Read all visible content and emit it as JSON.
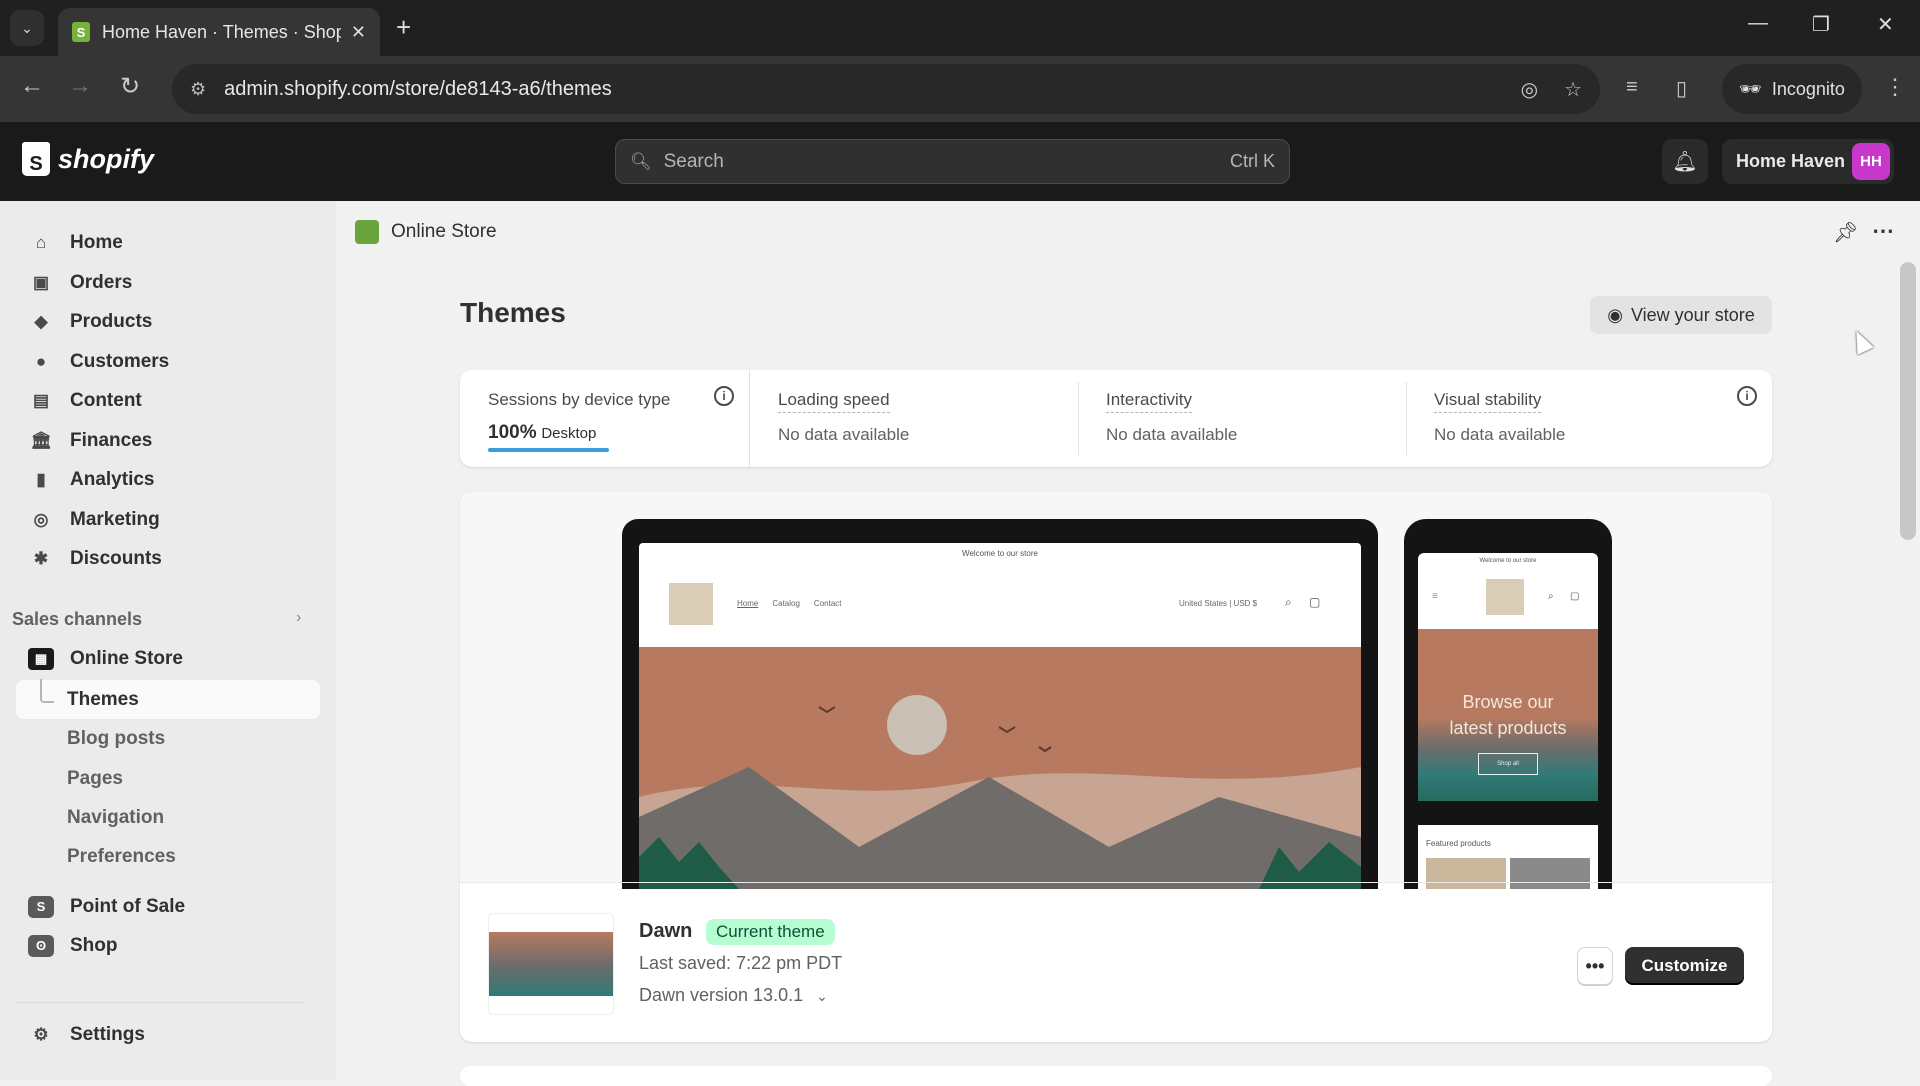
{
  "browser": {
    "tab_title": "Home Haven · Themes · Shopify",
    "url": "admin.shopify.com/store/de8143-a6/themes",
    "profile_label": "Incognito",
    "new_tab_symbol": "+",
    "icons": [
      "tab-search-icon",
      "shopify-favicon",
      "close-tab-icon",
      "back-icon",
      "forward-icon",
      "reload-icon",
      "site-settings-icon",
      "eye-off-icon",
      "star-icon",
      "media-icon",
      "sidebar-icon",
      "incognito-icon",
      "menu-icon",
      "minimize-icon",
      "restore-icon",
      "close-window-icon"
    ]
  },
  "topbar": {
    "logo_text": "shopify",
    "search_placeholder": "Search",
    "search_shortcut": "Ctrl K",
    "store_name": "Home Haven",
    "avatar_initials": "HH",
    "avatar_color": "#c837cb"
  },
  "sidebar": {
    "items": [
      {
        "label": "Home",
        "icon": "home-icon"
      },
      {
        "label": "Orders",
        "icon": "orders-icon"
      },
      {
        "label": "Products",
        "icon": "tag-icon"
      },
      {
        "label": "Customers",
        "icon": "person-icon"
      },
      {
        "label": "Content",
        "icon": "content-icon"
      },
      {
        "label": "Finances",
        "icon": "bank-icon"
      },
      {
        "label": "Analytics",
        "icon": "chart-icon"
      },
      {
        "label": "Marketing",
        "icon": "target-icon"
      },
      {
        "label": "Discounts",
        "icon": "discount-icon"
      }
    ],
    "sales_channels_label": "Sales channels",
    "online_store": "Online Store",
    "sub_items": [
      "Themes",
      "Blog posts",
      "Pages",
      "Navigation",
      "Preferences"
    ],
    "active_sub": "Themes",
    "apps": [
      "Point of Sale",
      "Shop"
    ],
    "settings": "Settings"
  },
  "main": {
    "breadcrumb": "Online Store",
    "title": "Themes",
    "view_store": "View your store",
    "metrics": {
      "sessions_label": "Sessions by device type",
      "sessions_percent": "100%",
      "sessions_device": "Desktop",
      "sessions_fraction": 1.0,
      "loading_label": "Loading speed",
      "loading_value": "No data available",
      "interactivity_label": "Interactivity",
      "interactivity_value": "No data available",
      "stability_label": "Visual stability",
      "stability_value": "No data available"
    },
    "preview": {
      "announcement": "Welcome to our store",
      "nav_links": [
        "Home",
        "Catalog",
        "Contact"
      ],
      "locale": "United States | USD $",
      "mobile_heading_1": "Browse our",
      "mobile_heading_2": "latest products",
      "mobile_button": "Shop all",
      "featured": "Featured products"
    },
    "theme": {
      "name": "Dawn",
      "badge": "Current theme",
      "last_saved": "Last saved: 7:22 pm PDT",
      "version": "Dawn version 13.0.1",
      "more_label": "•••",
      "customize_label": "Customize"
    }
  }
}
